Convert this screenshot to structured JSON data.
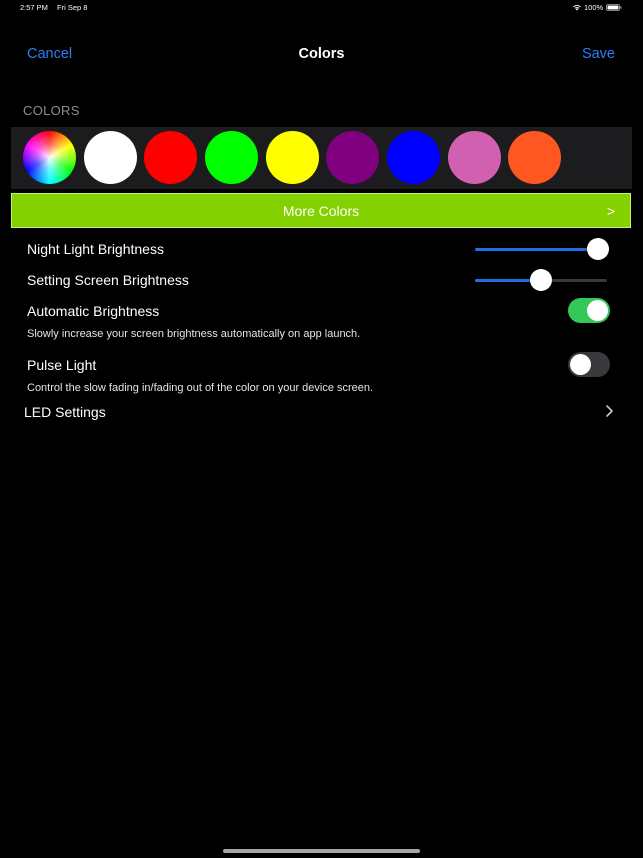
{
  "status_bar": {
    "time": "2:57 PM",
    "date": "Fri Sep 8",
    "battery": "100%"
  },
  "nav": {
    "cancel": "Cancel",
    "title": "Colors",
    "save": "Save"
  },
  "colors_section": {
    "header": "COLORS",
    "swatches": [
      {
        "name": "color-wheel",
        "color": "multicolor"
      },
      {
        "name": "white",
        "color": "#ffffff"
      },
      {
        "name": "red",
        "color": "#ff0000"
      },
      {
        "name": "green",
        "color": "#00ff00"
      },
      {
        "name": "yellow",
        "color": "#ffff00"
      },
      {
        "name": "purple",
        "color": "#800080"
      },
      {
        "name": "blue",
        "color": "#0000ff"
      },
      {
        "name": "pink",
        "color": "#d260b0"
      },
      {
        "name": "orange",
        "color": "#ff5722"
      }
    ]
  },
  "more_colors": {
    "label": "More Colors",
    "arrow": ">",
    "bg_color": "#84d100"
  },
  "settings": {
    "night_light_brightness": {
      "label": "Night Light Brightness",
      "value": 0.93
    },
    "setting_screen_brightness": {
      "label": "Setting Screen Brightness",
      "value": 0.5
    },
    "automatic_brightness": {
      "label": "Automatic Brightness",
      "description": "Slowly increase your screen brightness automatically on app launch.",
      "on": true
    },
    "pulse_light": {
      "label": "Pulse Light",
      "description": "Control the slow fading in/fading out of the color on your device screen.",
      "on": false
    },
    "led_settings": {
      "label": "LED Settings"
    }
  },
  "theme": {
    "accent": "#2f7cf6",
    "slider_fill": "#1e6fe0",
    "toggle_on": "#34c759",
    "toggle_off": "#39393d"
  }
}
